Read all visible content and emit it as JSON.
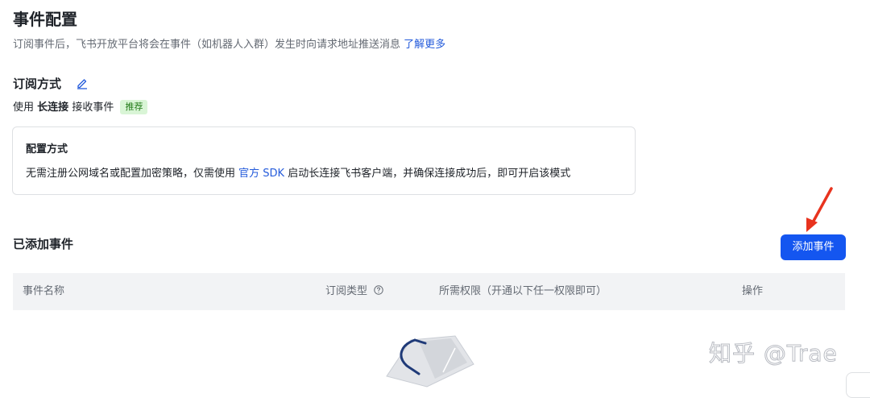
{
  "page": {
    "title": "事件配置",
    "description": "订阅事件后，飞书开放平台将会在事件（如机器人入群）发生时向请求地址推送消息",
    "learn_more": "了解更多"
  },
  "subscription": {
    "title": "订阅方式",
    "prefix": "使用",
    "mode": "长连接",
    "suffix": "接收事件",
    "badge": "推荐"
  },
  "config_card": {
    "title": "配置方式",
    "text_before": "无需注册公网域名或配置加密策略，仅需使用",
    "link": "官方 SDK",
    "text_after": "启动长连接飞书客户端，并确保连接成功后，即可开启该模式"
  },
  "events": {
    "title": "已添加事件",
    "add_button": "添加事件",
    "columns": [
      "事件名称",
      "订阅类型",
      "所需权限（开通以下任一权限即可）",
      "操作"
    ]
  },
  "watermark": "知乎 @Trae",
  "icons": {
    "edit": "pencil-edit-icon",
    "help": "question-circle-icon",
    "annotation": "red-arrow-icon"
  },
  "colors": {
    "primary": "#1456f0",
    "link": "#245bdb",
    "badge_bg": "#d9f5d6",
    "badge_text": "#237b19",
    "arrow": "#e8331e"
  }
}
